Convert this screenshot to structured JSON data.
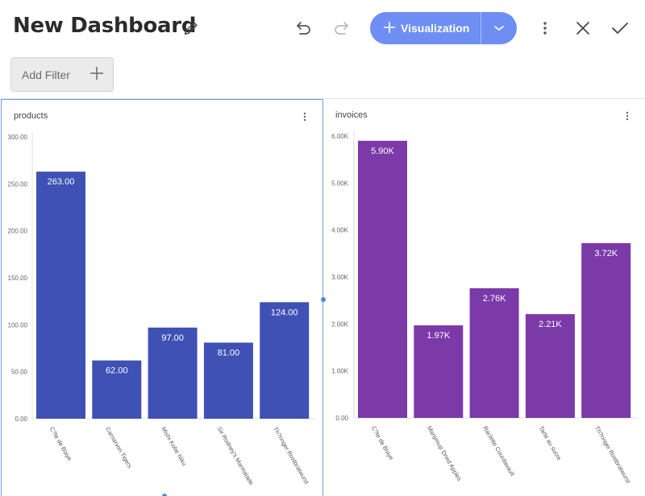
{
  "header": {
    "title": "New Dashboard",
    "add_viz_label": "Visualization"
  },
  "filter": {
    "label": "Add Filter"
  },
  "icons": {
    "edit": "pencil-icon",
    "undo": "undo-icon",
    "redo": "redo-icon",
    "add": "plus-icon",
    "dropdown": "chevron-down-icon",
    "more": "more-vertical-icon",
    "close": "close-icon",
    "confirm": "check-icon"
  },
  "colors": {
    "accent": "#6f8ef4",
    "products_bar": "#3f51b5",
    "invoices_bar": "#7b3aa8",
    "selection": "#6d9fd0"
  },
  "chart_data": [
    {
      "type": "bar",
      "title": "products",
      "categories": [
        "C?te de Blaye",
        "Carnarvon Tigers",
        "Mishi Kobe Niku",
        "Sir Rodney's Marmalade",
        "Th?ringer Rostbratwurst"
      ],
      "values": [
        263,
        62,
        97,
        81,
        124
      ],
      "value_labels": [
        "263.00",
        "62.00",
        "97.00",
        "81.00",
        "124.00"
      ],
      "yticks": [
        "0.00",
        "50.00",
        "100.00",
        "150.00",
        "200.00",
        "250.00",
        "300.00"
      ],
      "ylim": [
        0,
        300
      ],
      "grid": false,
      "color": "#3f51b5"
    },
    {
      "type": "bar",
      "title": "invoices",
      "categories": [
        "C?te de Blaye",
        "Manjimup Dried Apples",
        "Raclette Courdavault",
        "Tarte au sucre",
        "Th?ringer Rostbratwurst"
      ],
      "values": [
        5900,
        1970,
        2760,
        2210,
        3720
      ],
      "value_labels": [
        "5.90K",
        "1.97K",
        "2.76K",
        "2.21K",
        "3.72K"
      ],
      "yticks": [
        "0.00",
        "1.00K",
        "2.00K",
        "3.00K",
        "4.00K",
        "5.00K",
        "6.00K"
      ],
      "ylim": [
        0,
        6000
      ],
      "grid": false,
      "color": "#7b3aa8"
    }
  ]
}
